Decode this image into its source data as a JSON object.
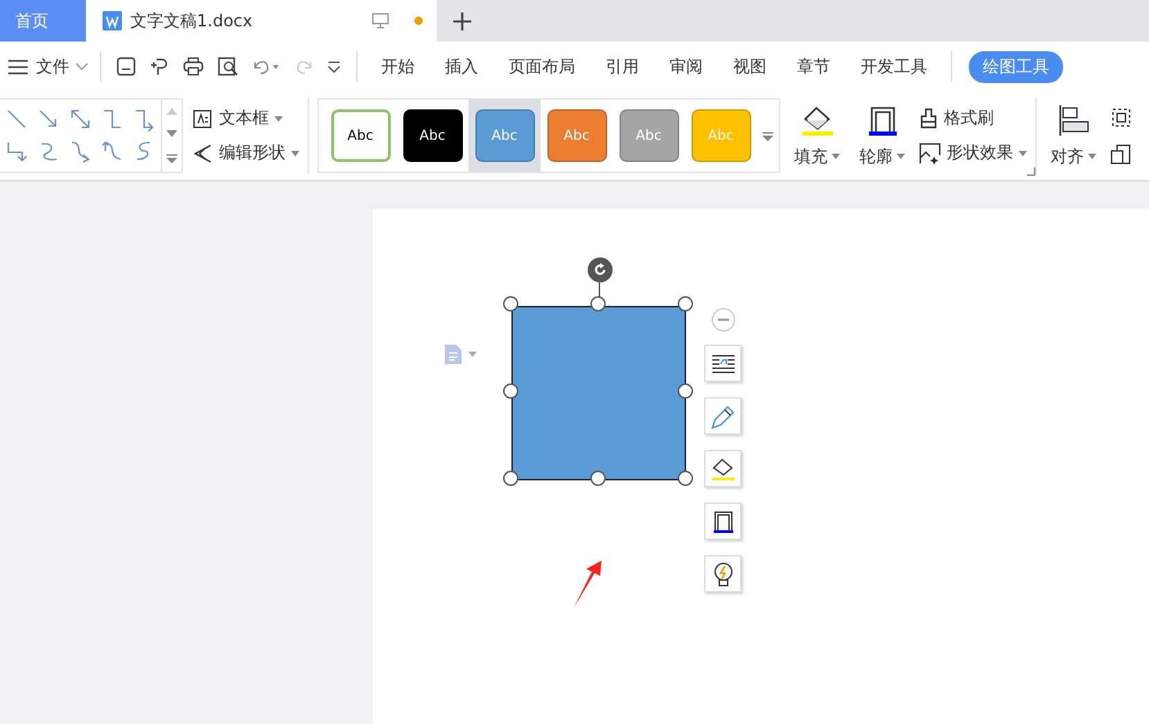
{
  "title_bar": {
    "home_tab": {
      "label": "首页"
    },
    "document_tab": {
      "label": "文字文稿1.docx",
      "unsaved": true
    }
  },
  "menu_bar": {
    "file_menu": "文件",
    "tabs": [
      {
        "label": "开始",
        "selected": false
      },
      {
        "label": "插入",
        "selected": false
      },
      {
        "label": "页面布局",
        "selected": false
      },
      {
        "label": "引用",
        "selected": false
      },
      {
        "label": "审阅",
        "selected": false
      },
      {
        "label": "视图",
        "selected": false
      },
      {
        "label": "章节",
        "selected": false
      },
      {
        "label": "开发工具",
        "selected": false
      },
      {
        "label": "绘图工具",
        "selected": true
      }
    ]
  },
  "ribbon": {
    "text_box": "文本框",
    "edit_shape": "编辑形状",
    "style_presets": [
      {
        "label": "Abc",
        "color": "#ffffff",
        "selected": false
      },
      {
        "label": "Abc",
        "color": "#000000",
        "selected": false
      },
      {
        "label": "Abc",
        "color": "#5b9bd5",
        "selected": true
      },
      {
        "label": "Abc",
        "color": "#ed7d31",
        "selected": false
      },
      {
        "label": "Abc",
        "color": "#a5a5a5",
        "selected": false
      },
      {
        "label": "Abc",
        "color": "#ffc000",
        "selected": false
      }
    ],
    "fill": "填充",
    "outline": "轮廓",
    "format_painter": "格式刷",
    "shape_effects": "形状效果",
    "align": "对齐"
  },
  "canvas": {
    "shape": {
      "color": "#5b9bd5",
      "selected": true
    }
  }
}
